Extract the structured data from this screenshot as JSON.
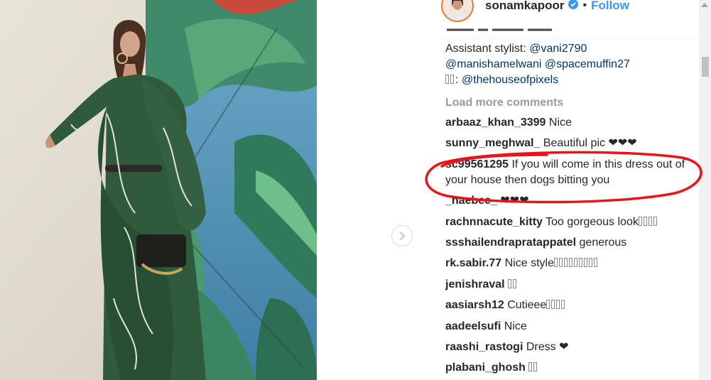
{
  "header": {
    "username": "sonamkapoor",
    "separator": "•",
    "follow_label": "Follow"
  },
  "caption": {
    "line1_prefix": "Assistant stylist: ",
    "line1_mention": "@vani2790",
    "line2": "@manishamelwani @spacemuffin27",
    "line3_prefix": ": ",
    "line3_mention": "@thehouseofpixels"
  },
  "load_more_label": "Load more comments",
  "comments": [
    {
      "author": "arbaaz_khan_3399",
      "text": "Nice",
      "glyphs": 0
    },
    {
      "author": "sunny_meghwal_",
      "text": "Beautiful pic ❤❤❤",
      "glyphs": 0
    },
    {
      "author": "sc99561295",
      "text": "If you will come in this dress out of your house then dogs bitting you",
      "glyphs": 0
    },
    {
      "author": "_haebee_",
      "text": "❤❤❤",
      "glyphs": 0
    },
    {
      "author": "rachnnacute_kitty",
      "text": "Too gorgeous look",
      "glyphs": 4
    },
    {
      "author": "ssshailendrapratappatel",
      "text": "generous",
      "glyphs": 0
    },
    {
      "author": "rk.sabir.77",
      "text": "Nice style",
      "glyphs": 9
    },
    {
      "author": "jenishraval",
      "text": "",
      "glyphs": 2
    },
    {
      "author": "aasiarsh12",
      "text": "Cutieee",
      "glyphs": 4
    },
    {
      "author": "aadeelsufi",
      "text": "Nice",
      "glyphs": 0
    },
    {
      "author": "raashi_rastogi",
      "text": "Dress ❤",
      "glyphs": 0
    },
    {
      "author": "plabani_ghosh",
      "text": "",
      "glyphs": 2
    }
  ],
  "icons": {
    "next": "chevron-right-icon",
    "verified": "verified-badge-icon",
    "annotation": "red-ellipse-annotation"
  },
  "colors": {
    "link": "#003569",
    "follow": "#3897f0",
    "muted": "#999999",
    "annotation": "#e8141c",
    "avatar_ring": "#e07b2c"
  }
}
